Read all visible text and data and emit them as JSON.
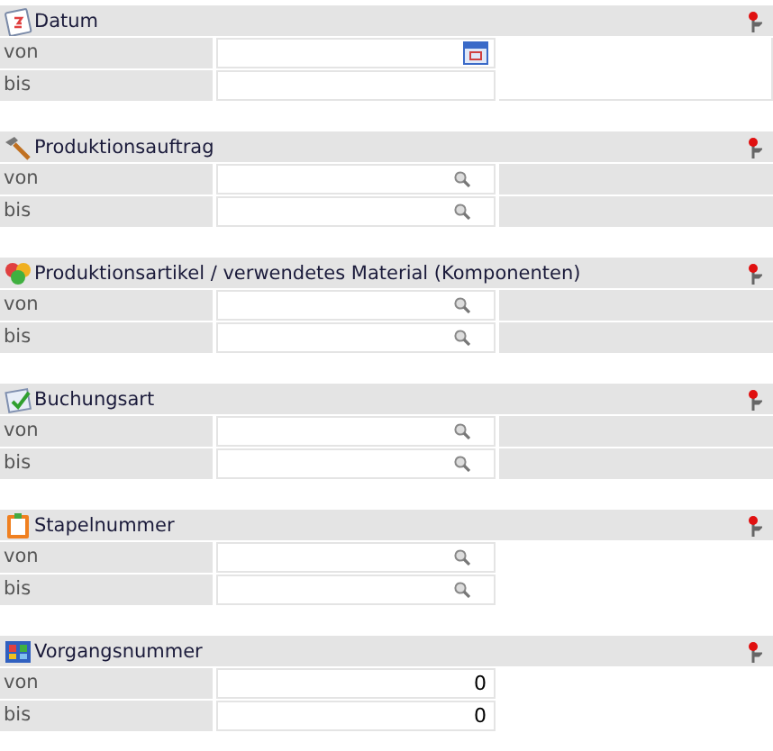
{
  "sections": [
    {
      "title": "Datum",
      "kind": "framed",
      "rows": [
        {
          "label": "von",
          "kind": "date",
          "value": ""
        },
        {
          "label": "bis",
          "kind": "plain",
          "value": ""
        }
      ]
    },
    {
      "title": "Produktionsauftrag",
      "kind": "celled",
      "rows": [
        {
          "label": "von",
          "kind": "lookup",
          "value": ""
        },
        {
          "label": "bis",
          "kind": "lookup",
          "value": ""
        }
      ]
    },
    {
      "title": "Produktionsartikel / verwendetes Material (Komponenten)",
      "kind": "celled",
      "rows": [
        {
          "label": "von",
          "kind": "lookup",
          "value": ""
        },
        {
          "label": "bis",
          "kind": "lookup",
          "value": ""
        }
      ]
    },
    {
      "title": "Buchungsart",
      "kind": "celled",
      "rows": [
        {
          "label": "von",
          "kind": "lookup",
          "value": ""
        },
        {
          "label": "bis",
          "kind": "lookup",
          "value": ""
        }
      ]
    },
    {
      "title": "Stapelnummer",
      "kind": "open",
      "rows": [
        {
          "label": "von",
          "kind": "lookup",
          "value": ""
        },
        {
          "label": "bis",
          "kind": "lookup",
          "value": ""
        }
      ]
    },
    {
      "title": "Vorgangsnummer",
      "kind": "open",
      "rows": [
        {
          "label": "von",
          "kind": "number",
          "value": "0"
        },
        {
          "label": "bis",
          "kind": "number",
          "value": "0"
        }
      ]
    }
  ]
}
